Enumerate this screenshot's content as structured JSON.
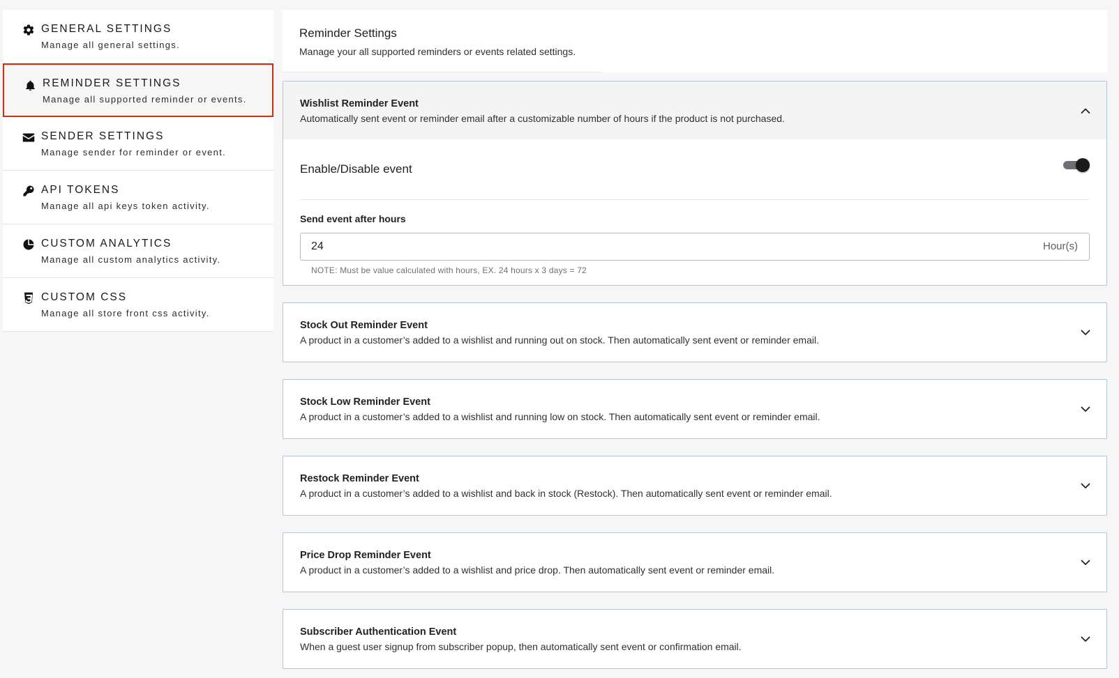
{
  "sidebar": {
    "items": [
      {
        "title": "GENERAL SETTINGS",
        "desc": "Manage all general settings.",
        "icon": "gear-icon"
      },
      {
        "title": "REMINDER SETTINGS",
        "desc": "Manage all supported reminder or events.",
        "icon": "bell-icon",
        "active": true
      },
      {
        "title": "SENDER SETTINGS",
        "desc": "Manage sender for reminder or event.",
        "icon": "envelope-icon"
      },
      {
        "title": "API TOKENS",
        "desc": "Manage all api keys token activity.",
        "icon": "key-icon"
      },
      {
        "title": "CUSTOM ANALYTICS",
        "desc": "Manage all custom analytics activity.",
        "icon": "pie-chart-icon"
      },
      {
        "title": "CUSTOM CSS",
        "desc": "Manage all store front css activity.",
        "icon": "css3-icon"
      }
    ]
  },
  "header": {
    "title": "Reminder Settings",
    "desc": "Manage your all supported reminders or events related settings."
  },
  "events": [
    {
      "title": "Wishlist Reminder Event",
      "desc": "Automatically sent event or reminder email after a customizable number of hours if the product is not purchased.",
      "expanded": true,
      "toggle_label": "Enable/Disable event",
      "toggle_on": true,
      "hours_label": "Send event after hours",
      "hours_value": "24",
      "hours_suffix": "Hour(s)",
      "note": "NOTE: Must be value calculated with hours, EX. 24 hours x 3 days = 72"
    },
    {
      "title": "Stock Out Reminder Event",
      "desc": "A product in a customer’s added to a wishlist and running out on stock. Then automatically sent event or reminder email."
    },
    {
      "title": "Stock Low Reminder Event",
      "desc": "A product in a customer’s added to a wishlist and running low on stock. Then automatically sent event or reminder email."
    },
    {
      "title": "Restock Reminder Event",
      "desc": "A product in a customer’s added to a wishlist and back in stock (Restock). Then automatically sent event or reminder email."
    },
    {
      "title": "Price Drop Reminder Event",
      "desc": "A product in a customer’s added to a wishlist and price drop. Then automatically sent event or reminder email."
    },
    {
      "title": "Subscriber Authentication Event",
      "desc": "When a guest user signup from subscriber popup, then automatically sent event or confirmation email."
    }
  ],
  "colors": {
    "active_border": "#d82c0d",
    "card_border": "#b7c2d6",
    "page_bg": "#f6f6f7"
  }
}
